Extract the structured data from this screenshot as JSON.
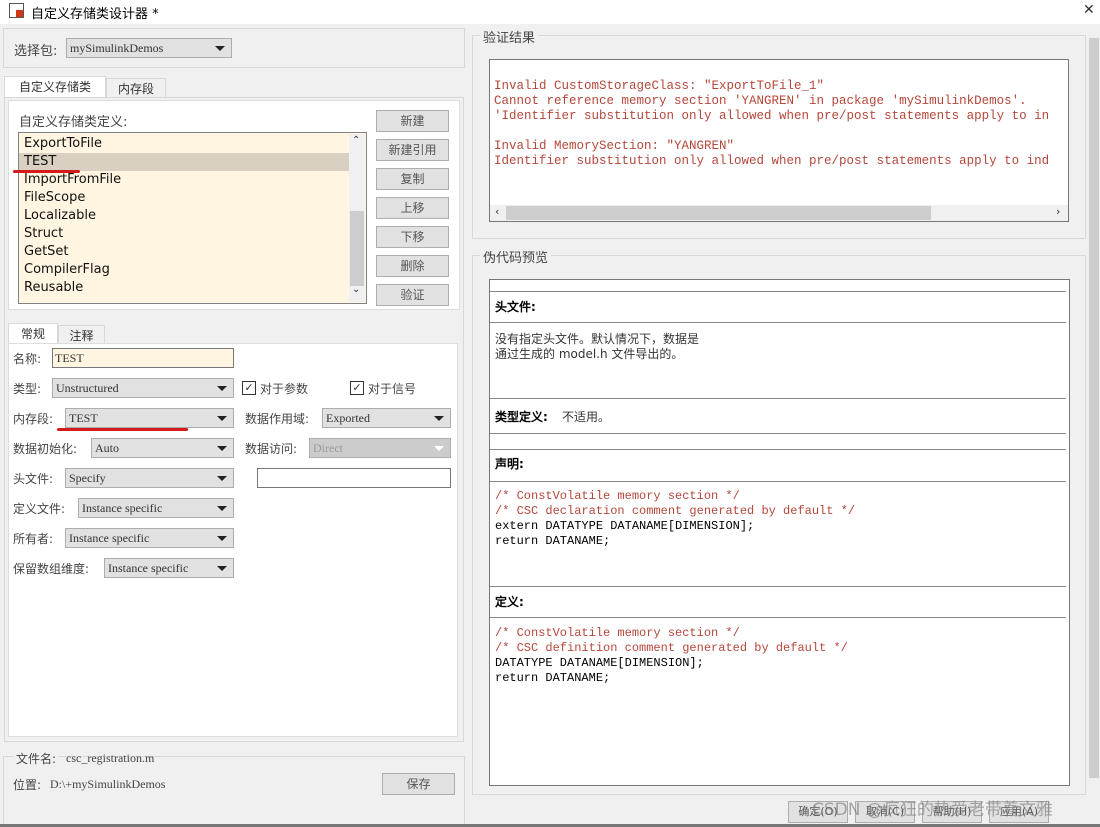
{
  "window": {
    "title": "自定义存储类设计器 *",
    "close": "✕"
  },
  "package": {
    "label": "选择包:",
    "value": "mySimulinkDemos"
  },
  "tabs": [
    "自定义存储类",
    "内存段"
  ],
  "csc": {
    "label": "自定义存储类定义:",
    "items": [
      "ExportToFile",
      "TEST",
      "ImportFromFile",
      "FileScope",
      "Localizable",
      "Struct",
      "GetSet",
      "CompilerFlag",
      "Reusable"
    ],
    "selected": "TEST",
    "buttons": [
      "新建",
      "新建引用",
      "复制",
      "上移",
      "下移",
      "删除",
      "验证"
    ]
  },
  "subtabs": [
    "常规",
    "注释"
  ],
  "form": {
    "name_label": "名称:",
    "name_value": "TEST",
    "type_label": "类型:",
    "type_value": "Unstructured",
    "for_params": "对于参数",
    "for_params_checked": true,
    "for_signals": "对于信号",
    "for_signals_checked": true,
    "memsec_label": "内存段:",
    "memsec_value": "TEST",
    "scope_label": "数据作用域:",
    "scope_value": "Exported",
    "init_label": "数据初始化:",
    "init_value": "Auto",
    "access_label": "数据访问:",
    "access_value": "Direct",
    "header_label": "头文件:",
    "header_value": "Specify",
    "header_file": "",
    "deffile_label": "定义文件:",
    "deffile_value": "Instance specific",
    "owner_label": "所有者:",
    "owner_value": "Instance specific",
    "dims_label": "保留数组维度:",
    "dims_value": "Instance specific"
  },
  "file": {
    "name_label": "文件名:",
    "name": "csc_registration.m",
    "loc_label": "位置:",
    "loc": "D:\\+mySimulinkDemos",
    "save": "保存"
  },
  "validation": {
    "title": "验证结果",
    "lines": [
      "Invalid CustomStorageClass: \"ExportToFile_1\"",
      "Cannot reference memory section 'YANGREN' in package 'mySimulinkDemos'.",
      "'Identifier substitution only allowed when pre/post statements apply to in",
      "",
      "Invalid MemorySection: \"YANGREN\"",
      "Identifier substitution only allowed when pre/post statements apply to ind"
    ]
  },
  "preview": {
    "title": "伪代码预览",
    "header_title": "头文件:",
    "header_text": "没有指定头文件。默认情况下，数据是\n通过生成的 model.h 文件导出的。",
    "typedef_title": "类型定义:",
    "typedef_text": "不适用。",
    "decl_title": "声明:",
    "decl_comment": "/* ConstVolatile memory section */\n/* CSC declaration comment generated by default */",
    "decl_code": "extern DATATYPE DATANAME[DIMENSION];\nreturn DATANAME;",
    "def_title": "定义:",
    "def_comment": "/* ConstVolatile memory section */\n/* CSC definition comment generated by default */",
    "def_code": "DATATYPE DATANAME[DIMENSION];\nreturn DATANAME;"
  },
  "footer": {
    "buttons": [
      "确定(O)",
      "取消(C)",
      "帮助(H)",
      "应用(A)"
    ],
    "watermark": "CSDN @疯狂的热爱老带着文雅"
  },
  "colors": {
    "list_bg": "#fff5e1",
    "selected": "#d9d0c1",
    "error_text": "#b5473a",
    "annotation": "#d51a1a"
  }
}
